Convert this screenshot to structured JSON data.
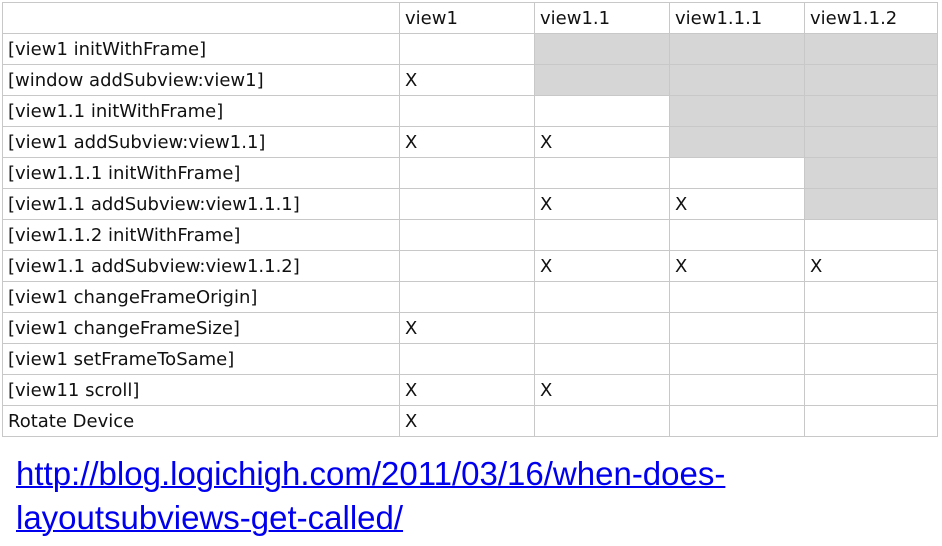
{
  "table": {
    "headers": [
      "",
      "view1",
      "view1.1",
      "view1.1.1",
      "view1.1.2"
    ],
    "rows": [
      {
        "label": "[view1 initWithFrame]",
        "cells": [
          "",
          "",
          "",
          ""
        ],
        "shaded": [
          false,
          true,
          true,
          true
        ]
      },
      {
        "label": "[window addSubview:view1]",
        "cells": [
          "X",
          "",
          "",
          ""
        ],
        "shaded": [
          false,
          true,
          true,
          true
        ]
      },
      {
        "label": "[view1.1 initWithFrame]",
        "cells": [
          "",
          "",
          "",
          ""
        ],
        "shaded": [
          false,
          false,
          true,
          true
        ]
      },
      {
        "label": "[view1 addSubview:view1.1]",
        "cells": [
          "X",
          "X",
          "",
          ""
        ],
        "shaded": [
          false,
          false,
          true,
          true
        ]
      },
      {
        "label": "[view1.1.1 initWithFrame]",
        "cells": [
          "",
          "",
          "",
          ""
        ],
        "shaded": [
          false,
          false,
          false,
          true
        ]
      },
      {
        "label": "[view1.1 addSubview:view1.1.1]",
        "cells": [
          "",
          "X",
          "X",
          ""
        ],
        "shaded": [
          false,
          false,
          false,
          true
        ]
      },
      {
        "label": "[view1.1.2 initWithFrame]",
        "cells": [
          "",
          "",
          "",
          ""
        ],
        "shaded": [
          false,
          false,
          false,
          false
        ]
      },
      {
        "label": "[view1.1 addSubview:view1.1.2]",
        "cells": [
          "",
          "X",
          "X",
          "X"
        ],
        "shaded": [
          false,
          false,
          false,
          false
        ]
      },
      {
        "label": "[view1 changeFrameOrigin]",
        "cells": [
          "",
          "",
          "",
          ""
        ],
        "shaded": [
          false,
          false,
          false,
          false
        ]
      },
      {
        "label": "[view1 changeFrameSize]",
        "cells": [
          "X",
          "",
          "",
          ""
        ],
        "shaded": [
          false,
          false,
          false,
          false
        ]
      },
      {
        "label": "[view1 setFrameToSame]",
        "cells": [
          "",
          "",
          "",
          ""
        ],
        "shaded": [
          false,
          false,
          false,
          false
        ]
      },
      {
        "label": "[view11 scroll]",
        "cells": [
          "X",
          "X",
          "",
          ""
        ],
        "shaded": [
          false,
          false,
          false,
          false
        ]
      },
      {
        "label": "Rotate Device",
        "cells": [
          "X",
          "",
          "",
          ""
        ],
        "shaded": [
          false,
          false,
          false,
          false
        ]
      }
    ]
  },
  "source_link": {
    "text": "http://blog.logichigh.com/2011/03/16/when-does-layoutsubviews-get-called/"
  },
  "colors": {
    "shade": "#d6d6d6",
    "link": "#0000ee",
    "border": "#c8c8c8"
  }
}
